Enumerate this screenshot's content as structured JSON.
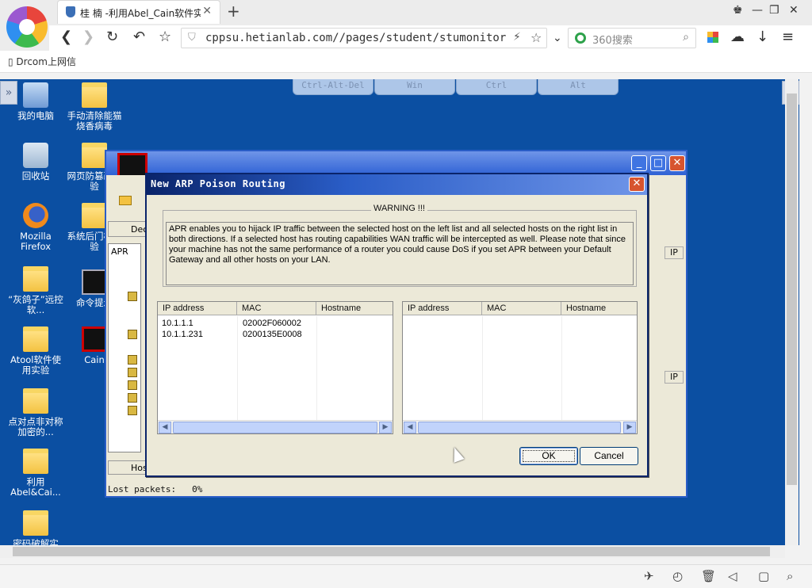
{
  "browser": {
    "tab_title": "桂 楠 -利用Abel_Cain软件实",
    "url": "cppsu.hetianlab.com//pages/student/stumonitor.js",
    "search_placeholder": "360搜索",
    "bookmark": "Drcom上网信"
  },
  "remote_keys": [
    "Ctrl-Alt-Del",
    "Win",
    "Ctrl",
    "Alt"
  ],
  "desktop_icons": [
    {
      "label": "我的电脑",
      "icon": "computer-icon"
    },
    {
      "label": "手动清除能猫烧香病毒",
      "icon": "folder-icon"
    },
    {
      "label": "回收站",
      "icon": "recycle-bin-icon"
    },
    {
      "label": "网页防篡改实验",
      "icon": "folder-icon"
    },
    {
      "label": "Mozilla Firefox",
      "icon": "firefox-icon"
    },
    {
      "label": "系统后门植实验",
      "icon": "folder-icon"
    },
    {
      "label": "“灰鸽子”远控软...",
      "icon": "folder-icon"
    },
    {
      "label": "命令提示",
      "icon": "cmd-icon"
    },
    {
      "label": "Atool软件使用实验",
      "icon": "folder-icon"
    },
    {
      "label": "Cain",
      "icon": "cain-icon"
    },
    {
      "label": "点对点非对称加密的...",
      "icon": "folder-icon"
    },
    {
      "label": "利用 Abel&Cai...",
      "icon": "folder-icon"
    },
    {
      "label": "密码破解实",
      "icon": "folder-icon"
    }
  ],
  "cain": {
    "tab_decoders": "Dec",
    "tree_root": "APR",
    "bottom_tab": "Hos",
    "status_label": "Lost packets:",
    "status_value": "0%",
    "col_ip": "IP"
  },
  "dialog": {
    "title": "New ARP Poison Routing",
    "warning_title": "WARNING !!!",
    "warning_text": "APR enables you to hijack IP traffic between the selected host on the left list and all selected hosts on the right list in both directions. If a selected host has routing capabilities WAN traffic will be intercepted as well. Please note that since your machine has not the same performance of a router you could cause DoS if you set APR between your Default Gateway and all other hosts on your LAN.",
    "columns": [
      "IP address",
      "MAC",
      "Hostname"
    ],
    "left_rows": [
      {
        "ip": "10.1.1.1",
        "mac": "02002F060002",
        "host": ""
      },
      {
        "ip": "10.1.1.231",
        "mac": "0200135E0008",
        "host": ""
      }
    ],
    "right_rows": [],
    "ok_label": "OK",
    "cancel_label": "Cancel"
  }
}
